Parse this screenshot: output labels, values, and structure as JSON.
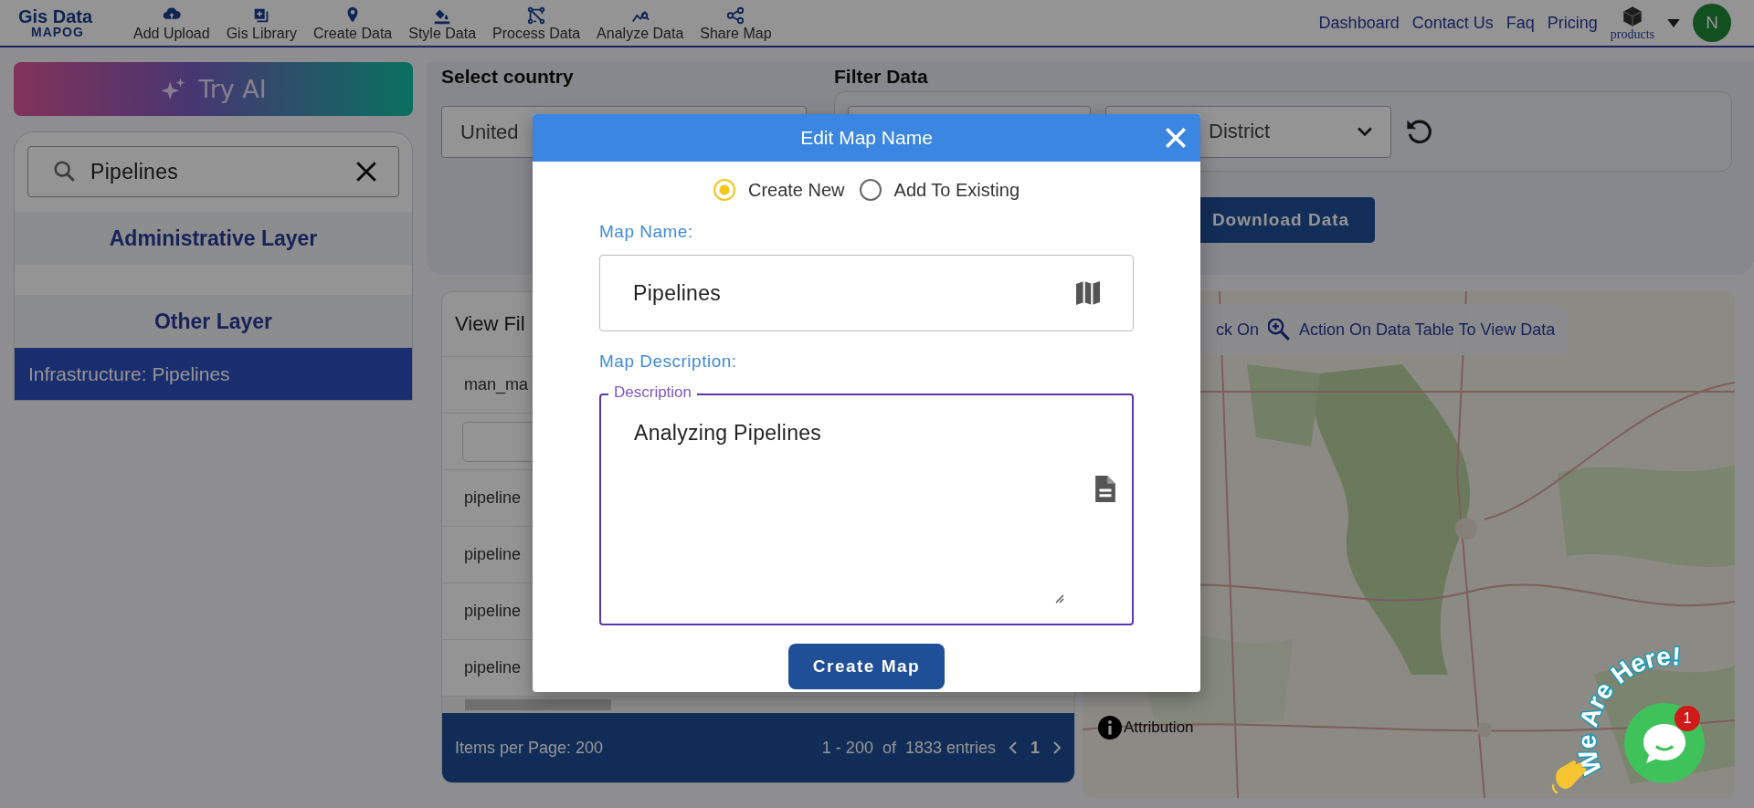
{
  "logo": {
    "line_1": "Gis Data",
    "line_2": "MAPOG"
  },
  "nav": [
    {
      "label": "Add Upload"
    },
    {
      "label": "Gis Library"
    },
    {
      "label": "Create Data"
    },
    {
      "label": "Style Data"
    },
    {
      "label": "Process Data"
    },
    {
      "label": "Analyze Data"
    },
    {
      "label": "Share Map"
    }
  ],
  "links": [
    "Dashboard",
    "Contact Us",
    "Faq",
    "Pricing"
  ],
  "products": {
    "label": "products"
  },
  "avatar": {
    "initial": "N"
  },
  "sidebar": {
    "try_ai": "Try AI",
    "search": {
      "value": "Pipelines"
    },
    "sections": [
      {
        "title": "Administrative Layer"
      },
      {
        "title": "Other Layer",
        "items": [
          {
            "label": "Infrastructure: Pipelines",
            "selected": true
          }
        ]
      }
    ]
  },
  "country": {
    "label": "Select country",
    "value": "United"
  },
  "filter": {
    "label": "Filter Data",
    "district": "District",
    "download": "Download Data"
  },
  "table": {
    "title": "View Fil",
    "column_1": "man_ma",
    "rows": [
      "pipeline",
      "pipeline",
      "pipeline",
      "pipeline"
    ],
    "footer": {
      "items_per_page": "Items per Page: 200",
      "range": "1 - 200  of  1833 entries",
      "page": "1"
    }
  },
  "map": {
    "hint_1": "ck On",
    "hint_2": "Action On Data Table To View Data",
    "attribution": "Attribution"
  },
  "chat": {
    "sticker": "We Are Here!",
    "badge": "1"
  },
  "modal": {
    "title": "Edit Map Name",
    "options": [
      {
        "label": "Create New",
        "selected": true
      },
      {
        "label": "Add To Existing",
        "selected": false
      }
    ],
    "name_label": "Map Name:",
    "name_value": "Pipelines",
    "desc_label": "Map Description:",
    "desc_legend": "Description",
    "desc_value": "Analyzing Pipelines",
    "submit": "Create Map"
  }
}
